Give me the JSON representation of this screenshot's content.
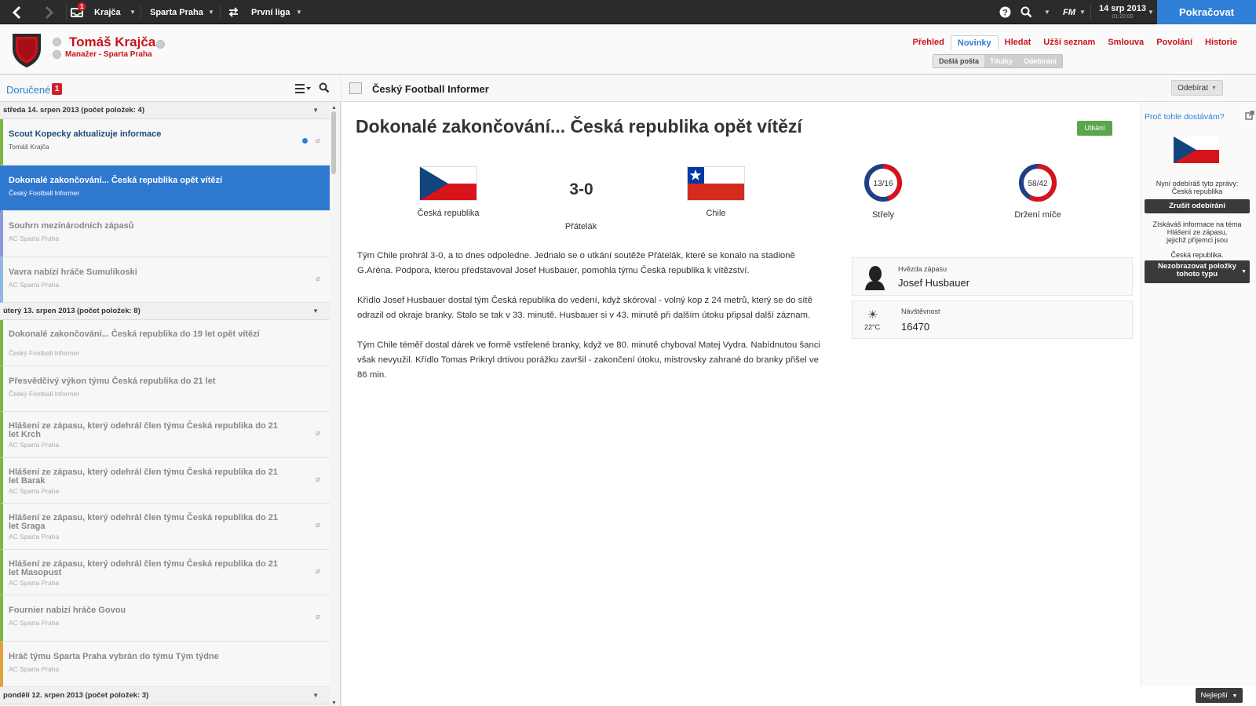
{
  "topbar": {
    "back_icon": "chevron-left-icon",
    "forward_icon": "chevron-right-icon",
    "inbox_badge": "1",
    "manager_menu": "Krajča",
    "club_menu": "Sparta Praha",
    "league_menu": "První liga",
    "date": "14 srp 2013",
    "time": "01:22:00",
    "logo": "FM",
    "continue_label": "Pokračovat"
  },
  "header": {
    "manager_name": "Tomáš Krajča",
    "manager_sub": "Manažer - Sparta Praha",
    "tabs": [
      "Přehled",
      "Novinky",
      "Hledat",
      "Užší seznam",
      "Smlouva",
      "Povolání",
      "Historie"
    ],
    "active_tab": "Novinky",
    "subtabs": [
      "Došlá pošta",
      "Titulky",
      "Odebírání"
    ],
    "active_subtab": "Došlá pošta"
  },
  "inbox": {
    "title": "Doručené",
    "unread_count": "1",
    "groups": [
      {
        "heading": "středa 14. srpen 2013 (počet položek: 4)",
        "items": [
          {
            "title": "Scout Kopecky aktualizuje informace",
            "sender": "Tomáš Krajča",
            "state": "unread",
            "attachment": true,
            "dot": true,
            "color": "#7ab648"
          },
          {
            "title": "Dokonalé zakončování... Česká republika opět vítězí",
            "sender": "Český Football Informer",
            "state": "selected",
            "attachment": false,
            "color": "#2e78d0"
          },
          {
            "title": "Souhrn mezinárodních zápasů",
            "sender": "AC Sparta Praha",
            "state": "read",
            "attachment": false,
            "color": "#8a9ad6"
          },
          {
            "title": "Vavra nabízí hráče Sumulikoski",
            "sender": "AC Sparta Praha",
            "state": "read",
            "attachment": true,
            "color": "#8fb8e0"
          }
        ]
      },
      {
        "heading": "úterý 13. srpen 2013 (počet položek: 8)",
        "items": [
          {
            "title": "Dokonalé zakončování... Česká republika do 19 let opět vítězí",
            "sender": "Český Football Informer",
            "state": "read",
            "attachment": false,
            "color": "#7ab648"
          },
          {
            "title": "Přesvědčivý výkon týmu Česká republika do 21 let",
            "sender": "Český Football Informer",
            "state": "read",
            "attachment": false,
            "color": "#7ab648"
          },
          {
            "title": "Hlášení ze zápasu, který odehrál člen týmu Česká republika do 21 let Krch",
            "sender": "AC Sparta Praha",
            "state": "read",
            "attachment": true,
            "color": "#7ab648"
          },
          {
            "title": "Hlášení ze zápasu, který odehrál člen týmu Česká republika do 21 let Barak",
            "sender": "AC Sparta Praha",
            "state": "read",
            "attachment": true,
            "color": "#7ab648"
          },
          {
            "title": "Hlášení ze zápasu, který odehrál člen týmu Česká republika do 21 let Sraga",
            "sender": "AC Sparta Praha",
            "state": "read",
            "attachment": true,
            "color": "#7ab648"
          },
          {
            "title": "Hlášení ze zápasu, který odehrál člen týmu Česká republika do 21 let Masopust",
            "sender": "AC Sparta Praha",
            "state": "read",
            "attachment": true,
            "color": "#7ab648"
          },
          {
            "title": "Fournier nabízí hráče Govou",
            "sender": "AC Sparta Praha",
            "state": "read",
            "attachment": true,
            "color": "#7ab648"
          },
          {
            "title": "Hráč týmu Sparta Praha vybrán do týmu Tým týdne",
            "sender": "AC Sparta Praha",
            "state": "read",
            "attachment": false,
            "color": "#e0a23c"
          }
        ]
      },
      {
        "heading": "pondělí 12. srpen 2013 (počet položek: 3)",
        "items": []
      }
    ]
  },
  "article": {
    "source": "Český Football Informer",
    "unsubscribe_label": "Odebírat",
    "headline": "Dokonalé zakončování... Česká republika opět vítězí",
    "match_button": "Utkání",
    "home_team": "Česká republika",
    "away_team": "Chile",
    "score": "3-0",
    "competition": "Přátelák",
    "shots": {
      "label": "Střely",
      "value": "13/16",
      "home": 13,
      "away": 16
    },
    "possession": {
      "label": "Držení míče",
      "value": "58/42",
      "home": 58,
      "away": 42
    },
    "paragraphs": [
      "Tým Chile prohrál 3-0, a to dnes odpoledne. Jednalo se o utkání soutěže Přátelák, které se konalo na stadioně G.Aréna. Podpora, kterou představoval Josef Husbauer, pomohla týmu Česká republika k vítězství.",
      "Křídlo Josef Husbauer dostal tým Česká republika do vedení, když skóroval - volný kop z 24 metrů, který se do sítě odrazil od okraje branky. Stalo se tak v 33. minutě. Husbauer si v 43. minutě při dalším útoku připsal další záznam.",
      "Tým Chile téměř dostal dárek ve formě vstřelené branky, když ve 80. minutě chyboval Matej Vydra. Nabídnutou šanci však nevyužil. Křídlo Tomas Prikryl drtivou porážku završil - zakončení útoku, mistrovsky zahrané do branky přišel ve 86 min."
    ],
    "star_label": "Hvězda zápasu",
    "star_value": "Josef Husbauer",
    "attendance_label": "Návštěvnost",
    "attendance_value": "16470",
    "temperature": "22°C",
    "weather_icon": "sun-icon"
  },
  "sidebar": {
    "why_link": "Proč tohle dostávám?",
    "subscribed_text": "Nyní odebíráš tyto zprávy:",
    "subscribed_item": "Česká republika",
    "cancel_button": "Zrušit odebírání",
    "info_text_1": "Získáváš informace na téma",
    "info_text_2": "Hlášení ze zápasu,",
    "info_text_3": "jejichž příjemci jsou",
    "info_text_4": "Česká republika.",
    "hide_button_1": "Nezobrazovat položky",
    "hide_button_2": "tohoto typu",
    "best_button": "Nejlepší"
  },
  "colors": {
    "accent_red": "#c8141c",
    "accent_blue": "#2f7fd0",
    "continue_blue": "#2f80d6",
    "match_green": "#5aa74b"
  }
}
